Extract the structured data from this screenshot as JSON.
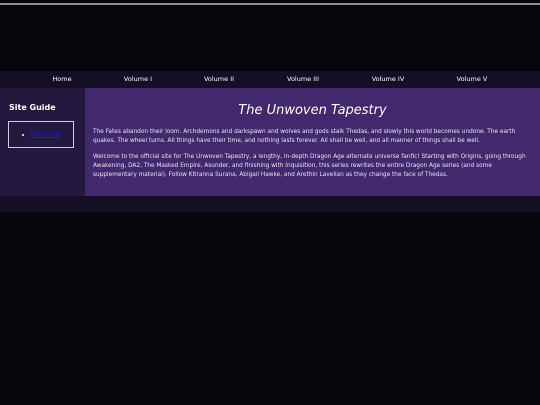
{
  "nav": {
    "items": [
      {
        "label": "Home"
      },
      {
        "label": "Volume I"
      },
      {
        "label": "Volume II"
      },
      {
        "label": "Volume III"
      },
      {
        "label": "Volume IV"
      },
      {
        "label": "Volume V"
      }
    ]
  },
  "sidebar": {
    "title": "Site Guide",
    "link_label": "Site Guide"
  },
  "main": {
    "title": "The Unwoven Tapestry",
    "paragraph_1": "The Fates abandon their loom. Archdemons and darkspawn and wolves and gods stalk Thedas, and slowly this world becomes undone. The earth quakes. The wheel turns. All things have their time, and nothing lasts forever. All shall be well, and all manner of things shall be well.",
    "paragraph_2": "Welcome to the official site for The Unwoven Tapestry, a lengthy, in-depth Dragon Age alternate universe fanfic! Starting with Origins, going through Awakening, DA2, The Masked Empire, Asunder, and finishing with Inquisition, this series rewrites the entire Dragon Age series (and some supplementary material). Follow Kitranna Surana, Abigail Hawke, and Arethin Lavellan as they change the face of Thedas."
  },
  "colors": {
    "background": "#08060c",
    "navbar": "#150f26",
    "sidebar": "#24183f",
    "main": "#42286c",
    "link": "#1a1fd6"
  }
}
